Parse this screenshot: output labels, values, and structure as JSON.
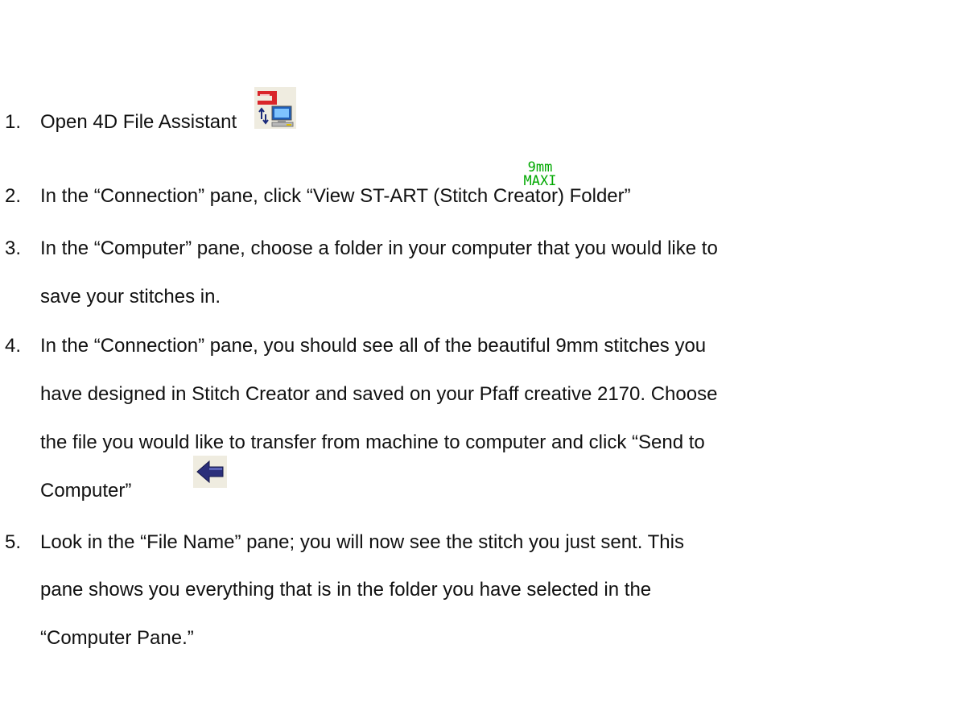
{
  "steps": [
    {
      "number": "1.",
      "lines": [
        "Open 4D File Assistant"
      ]
    },
    {
      "number": "2.",
      "lines": [
        "In the “Connection” pane, click “View ST-ART (Stitch Creator) Folder”"
      ]
    },
    {
      "number": "3.",
      "lines": [
        "In the “Computer” pane, choose a folder in your computer that you would like to",
        "save your stitches in."
      ]
    },
    {
      "number": "4.",
      "lines": [
        "In the “Connection” pane, you should see all of the beautiful 9mm stitches you",
        "have designed in Stitch Creator and saved on your Pfaff creative 2170.  Choose",
        "the file you would like to transfer from machine to computer and click “Send to",
        "Computer”"
      ]
    },
    {
      "number": "5.",
      "lines": [
        "Look in the “File Name” pane; you will now see the stitch you just sent.  This",
        "pane shows you everything that is in the folder you have selected in the",
        "“Computer Pane.”"
      ]
    }
  ],
  "icons": {
    "file_assistant": "file-assistant-icon",
    "stitch_folder": {
      "name": "9mm-maxi-icon",
      "top_text": "9mm",
      "bottom_text": "MAXI",
      "color": "#00a800"
    },
    "send_to_computer": "left-arrow-icon"
  },
  "colors": {
    "text": "#111111",
    "arrow": "#2b2f7a",
    "icon_red": "#d9252a"
  }
}
